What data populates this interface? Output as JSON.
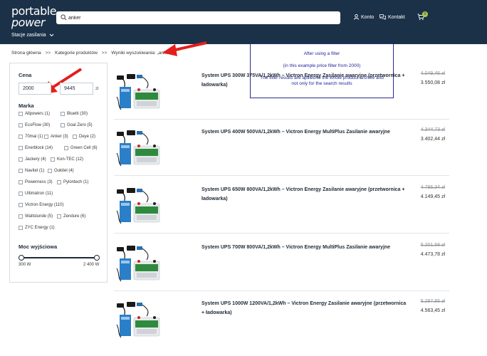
{
  "header": {
    "logo_line1": "portable",
    "logo_line2": "power",
    "search_value": "anker",
    "account_label": "Konto",
    "contact_label": "Kontakt",
    "cart_count": "0",
    "category_menu": "Stacje zasilania"
  },
  "breadcrumb": {
    "items": [
      "Strona główna",
      "Kategorie produktów",
      "Wyniki wyszukiwania: „anker”"
    ],
    "separator": ">>"
  },
  "annotation": {
    "line1": "After using a filter",
    "line2": "(in this example price filter from 2000)",
    "line3": "The filter results are apllied to the whole product archive and not only for the search results"
  },
  "filters": {
    "price": {
      "heading": "Cena",
      "min": "2000",
      "max": "9445",
      "currency": "zł"
    },
    "brand": {
      "heading": "Marka",
      "options": [
        "Allpowers (1)",
        "Bluetti (30)",
        "EcoFlow (30)",
        "Goal Zero (5)",
        "70mai (1)",
        "Anker (3)",
        "Deye (2)",
        "Enerblock (14)",
        "Green Cell (6)",
        "Jackery (4)",
        "Kon-TEC (12)",
        "Navitel (1)",
        "Oukitel (4)",
        "Powerness (3)",
        "Pylontech (1)",
        "Ultimatron (11)",
        "Victron Energy (110)",
        "Wattstunde (5)",
        "Zendure (6)",
        "ZYC Energy (1)"
      ]
    },
    "power": {
      "heading": "Moc wyjściowa",
      "min_label": "300 W",
      "max_label": "2 400 W"
    }
  },
  "products": [
    {
      "title": "System UPS 300W 375VA/1,2kWh – Victron Energy Zasilanie awaryjne (przetwornica + ładowarka)",
      "old_price": "4.049,46 zł",
      "price": "3.550,08 zł"
    },
    {
      "title": "System UPS 400W 500VA/1,2kWh – Victron Energy MultiPlus Zasilanie awaryjne",
      "old_price": "4.344,73 zł",
      "price": "3.402,44 zł"
    },
    {
      "title": "System UPS 650W 800VA/1,2kWh – Victron Energy Zasilanie awaryjne (przetwornica + ładowarka)",
      "old_price": "4.786,34 zł",
      "price": "4.149,45 zł"
    },
    {
      "title": "System UPS 700W 800VA/1,2kWh – Victron Energy MultiPlus Zasilanie awaryjne",
      "old_price": "5.201,58 zł",
      "price": "4.473,78 zł"
    },
    {
      "title": "System UPS 1000W 1200VA/1,2kWh – Victron Energy Zasilanie awaryjne (przetwornica + ładowarka)",
      "old_price": "5.287,65 zł",
      "price": "4.563,45 zł"
    }
  ],
  "colors": {
    "header_bg": "#1b3148",
    "accent": "#a9c94a",
    "annotation_arrow": "#e41e1e",
    "annotation_text": "#1f1f9a"
  }
}
